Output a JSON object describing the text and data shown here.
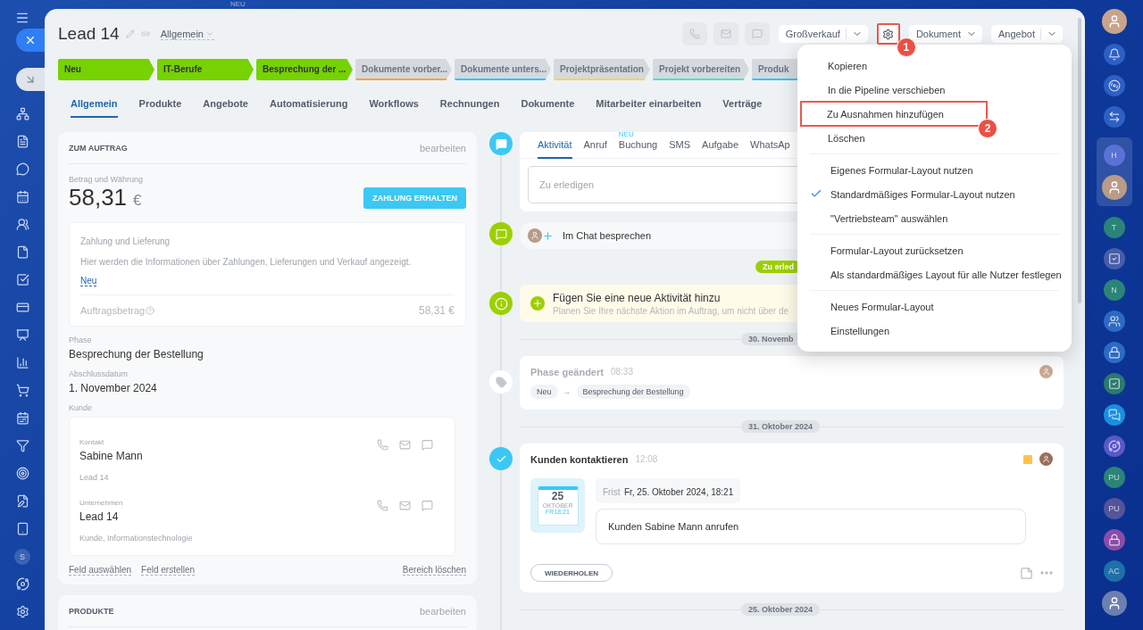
{
  "top_badge": "NEU",
  "left_rail": {
    "user_initial": "S"
  },
  "header": {
    "title": "Lead 14",
    "category": "Allgemein",
    "quick_actions": [
      {
        "disabled": true
      },
      {
        "disabled": true
      },
      {
        "disabled": true
      }
    ],
    "actions": [
      {
        "kind": "split",
        "label": "Großverkauf"
      },
      {
        "kind": "gear",
        "callout": "1"
      },
      {
        "kind": "dropdown",
        "label": "Dokument"
      },
      {
        "kind": "split",
        "label": "Angebot"
      }
    ]
  },
  "stages": [
    {
      "label": "Neu",
      "reached": true,
      "color": "#76d200"
    },
    {
      "label": "IT-Berufe",
      "reached": true,
      "color": "#76d200"
    },
    {
      "label": "Besprechung der ...",
      "reached": true,
      "color": "#76d200"
    },
    {
      "label": "Dokumente vorber...",
      "reached": false,
      "color": "#f7a23a"
    },
    {
      "label": "Dokumente unters...",
      "reached": false,
      "color": "#2fc6f6"
    },
    {
      "label": "Projektpräsentation",
      "reached": false,
      "color": "#f5d35c"
    },
    {
      "label": "Projekt vorbereiten",
      "reached": false,
      "color": "#47e4c2"
    },
    {
      "label": "Produk",
      "reached": false,
      "color": "#2fc6f6"
    }
  ],
  "tabs": [
    {
      "label": "Allgemein",
      "selected": true
    },
    {
      "label": "Produkte",
      "selected": false
    },
    {
      "label": "Angebote",
      "selected": false
    },
    {
      "label": "Automatisierung",
      "selected": false
    },
    {
      "label": "Workflows",
      "selected": false
    },
    {
      "label": "Rechnungen",
      "selected": false
    },
    {
      "label": "Dokumente",
      "selected": false
    },
    {
      "label": "Mitarbeiter einarbeiten",
      "selected": false
    },
    {
      "label": "Verträge",
      "selected": false
    }
  ],
  "order_card": {
    "title": "ZUM AUFTRAG",
    "edit": "bearbeiten",
    "amount_label": "Betrag und Währung",
    "amount": "58,31",
    "currency": "€",
    "pay_button": "ZAHLUNG ERHALTEN",
    "payment": {
      "title": "Zahlung und Lieferung",
      "description": "Hier werden die Informationen über Zahlungen, Lieferungen und Verkauf angezeigt.",
      "link": "Neu",
      "total_label": "Auftragsbetrag",
      "total": "58,31 €"
    },
    "fields": [
      {
        "label": "Phase",
        "value": "Besprechung der Bestellung"
      },
      {
        "label": "Abschlussdatum",
        "value": "1. November 2024"
      }
    ],
    "client_label": "Kunde",
    "clients": [
      {
        "type": "Kontakt",
        "name": "Sabine Mann",
        "sub": "Lead 14"
      },
      {
        "type": "Unternehmen",
        "name": "Lead 14",
        "sub": "Kunde, Informationstechnologie"
      }
    ],
    "footer_links": [
      "Feld auswählen",
      "Feld erstellen"
    ],
    "remove_link": "Bereich löschen"
  },
  "products_card": {
    "title": "PRODUKTE",
    "edit": "bearbeiten"
  },
  "timeline": [
    {
      "kind": "composer",
      "tabs": [
        {
          "label": "Aktivität",
          "selected": true
        },
        {
          "label": "Anruf",
          "selected": false
        },
        {
          "label": "Buchung",
          "selected": false,
          "badge": "NEU"
        },
        {
          "label": "SMS",
          "selected": false
        },
        {
          "label": "Aufgabe",
          "selected": false
        },
        {
          "label": "WhatsAp",
          "selected": false
        }
      ],
      "placeholder": "Zu erledigen"
    },
    {
      "kind": "chat",
      "label": "Im Chat besprechen"
    },
    {
      "kind": "pill",
      "label": "Zu erled"
    },
    {
      "kind": "banner",
      "title": "Fügen Sie eine neue Aktivität hinzu",
      "subtitle": "Planen Sie Ihre nächste Aktion im Auftrag, um nicht über de"
    },
    {
      "kind": "date",
      "label": "30. Novemb"
    },
    {
      "kind": "phase",
      "title": "Phase geändert",
      "time": "08:33",
      "from": "Neu",
      "arrow": "→",
      "to": "Besprechung der Bestellung"
    },
    {
      "kind": "date",
      "label": "31. Oktober 2024"
    },
    {
      "kind": "task",
      "title": "Kunden kontaktieren",
      "time": "12:08",
      "color": "#ffc34d",
      "calendar": {
        "day": "25",
        "month": "OKTOBER",
        "time": "FR18:21"
      },
      "deadline_label": "Frist",
      "deadline": "Fr, 25. Oktober 2024, 18:21",
      "text": "Kunden Sabine Mann anrufen",
      "button": "WIEDERHOLEN"
    },
    {
      "kind": "date",
      "label": "25. Oktober 2024"
    }
  ],
  "menu": {
    "sections": [
      {
        "items": [
          {
            "label": "Kopieren",
            "checked": false
          },
          {
            "label": "In die Pipeline verschieben",
            "checked": false
          },
          {
            "label": "Zu Ausnahmen hinzufügen",
            "checked": false,
            "callout": "2"
          },
          {
            "label": "Löschen",
            "checked": false
          }
        ]
      },
      {
        "items": [
          {
            "label": "Eigenes Formular-Layout nutzen",
            "checked": false
          },
          {
            "label": "Standardmäßiges Formular-Layout nutzen",
            "checked": true
          },
          {
            "label": "\"Vertriebsteam\" auswählen",
            "checked": false
          }
        ]
      },
      {
        "items": [
          {
            "label": "Formular-Layout zurücksetzen",
            "checked": false
          },
          {
            "label": "Als standardmäßiges Layout für alle Nutzer festlegen",
            "checked": false
          }
        ]
      },
      {
        "items": [
          {
            "label": "Neues Formular-Layout",
            "checked": false
          },
          {
            "label": "Einstellungen",
            "checked": false
          }
        ]
      }
    ]
  },
  "right_rail": [
    {
      "kind": "avatar",
      "color": "#c9a48a"
    },
    {
      "kind": "icon",
      "color": "#2d5fc4"
    },
    {
      "kind": "icon",
      "color": "#2d5fc4"
    },
    {
      "kind": "icon",
      "color": "#2d5fc4"
    },
    {
      "kind": "group",
      "children": [
        {
          "kind": "letter",
          "label": "H",
          "color": "#5a72d6"
        },
        {
          "kind": "avatar",
          "color": "#b89b88"
        }
      ]
    },
    {
      "kind": "letter",
      "label": "T",
      "color": "#2b8477"
    },
    {
      "kind": "icon",
      "color": "#4a5da8"
    },
    {
      "kind": "letter",
      "label": "N",
      "color": "#2b8477"
    },
    {
      "kind": "icon",
      "color": "#2d6ac4"
    },
    {
      "kind": "icon",
      "color": "#2d6ac4"
    },
    {
      "kind": "icon",
      "color": "#2b7a6e"
    },
    {
      "kind": "icon",
      "color": "#1a8fe0"
    },
    {
      "kind": "icon",
      "color": "#5a58c8"
    },
    {
      "kind": "letter",
      "label": "PU",
      "color": "#2b8477"
    },
    {
      "kind": "letter",
      "label": "PU",
      "color": "#54549a"
    },
    {
      "kind": "icon",
      "color": "#8a4ca8"
    },
    {
      "kind": "letter",
      "label": "AC",
      "color": "#1e70a8"
    },
    {
      "kind": "avatar",
      "color": "#6d7fb0"
    }
  ]
}
